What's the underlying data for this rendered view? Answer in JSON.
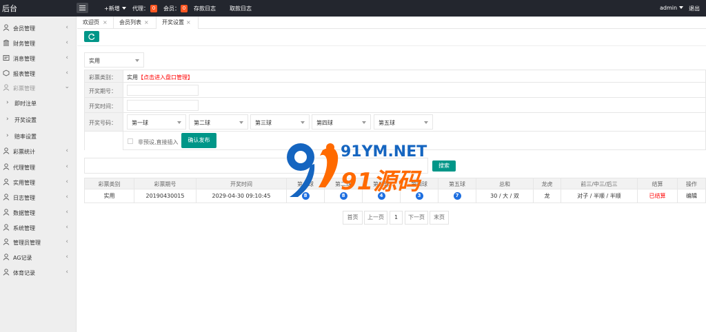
{
  "app": {
    "title": "后台"
  },
  "topnav": {
    "add_label": "+新增",
    "agent_label": "代理：",
    "agent_count": "0",
    "member_label": "会员：",
    "member_count": "0",
    "deposit_log": "存款日志",
    "withdraw_log": "取款日志",
    "user": "admin",
    "logout": "退出"
  },
  "sidebar": {
    "items": [
      {
        "label": "会员管理"
      },
      {
        "label": "财务管理"
      },
      {
        "label": "消息管理"
      },
      {
        "label": "报表管理"
      },
      {
        "label": "彩票管理"
      },
      {
        "label": "即时注单"
      },
      {
        "label": "开奖设置"
      },
      {
        "label": "赔率设置"
      },
      {
        "label": "彩票统计"
      },
      {
        "label": "代理管理"
      },
      {
        "label": "实用管理"
      },
      {
        "label": "日志管理"
      },
      {
        "label": "数据管理"
      },
      {
        "label": "系统管理"
      },
      {
        "label": "管理员管理"
      },
      {
        "label": "AG记录"
      },
      {
        "label": "体育记录"
      }
    ]
  },
  "tabs": [
    {
      "label": "欢迎页"
    },
    {
      "label": "会员列表"
    },
    {
      "label": "开奖设置"
    }
  ],
  "filter": {
    "type_value": "实用"
  },
  "form": {
    "type_label": "彩票类别：",
    "type_value": "实用",
    "type_link": "【点击进入盘口管理】",
    "period_label": "开奖期号：",
    "time_label": "开奖时间：",
    "numbers_label": "开奖号码：",
    "balls": [
      "第一球",
      "第二球",
      "第三球",
      "第四球",
      "第五球"
    ],
    "checkbox_label": "非预设,直接插入",
    "submit_label": "确认发布"
  },
  "search": {
    "button_label": "搜索"
  },
  "table": {
    "headers": [
      "彩票类别",
      "彩票期号",
      "开奖时间",
      "第一球",
      "第二球",
      "第三球",
      "第四球",
      "第五球",
      "总和",
      "龙虎",
      "前三/中三/后三",
      "结算",
      "操作"
    ],
    "row": {
      "type": "实用",
      "period": "20190430015",
      "time": "2029-04-30 09:10:45",
      "balls": [
        "8",
        "8",
        "4",
        "3",
        "7"
      ],
      "sum": "30 / 大 / 双",
      "dragon_tiger": "龙",
      "front_mid_back": "对子 / 半顺 / 半顺",
      "status": "已结算",
      "action": "编辑"
    }
  },
  "pagination": {
    "first": "首页",
    "prev": "上一页",
    "page": "1",
    "next": "下一页",
    "last": "末页"
  },
  "watermark": {
    "top": "91YM.NET",
    "bottom": "91源码"
  },
  "colors": {
    "accent": "#009688",
    "topbar": "#23262e",
    "badge": "#ff5722",
    "link_red": "#ff0000",
    "ball_blue": "#1e6fe0",
    "watermark_blue": "#1565c0",
    "watermark_orange": "#ff6a00"
  }
}
